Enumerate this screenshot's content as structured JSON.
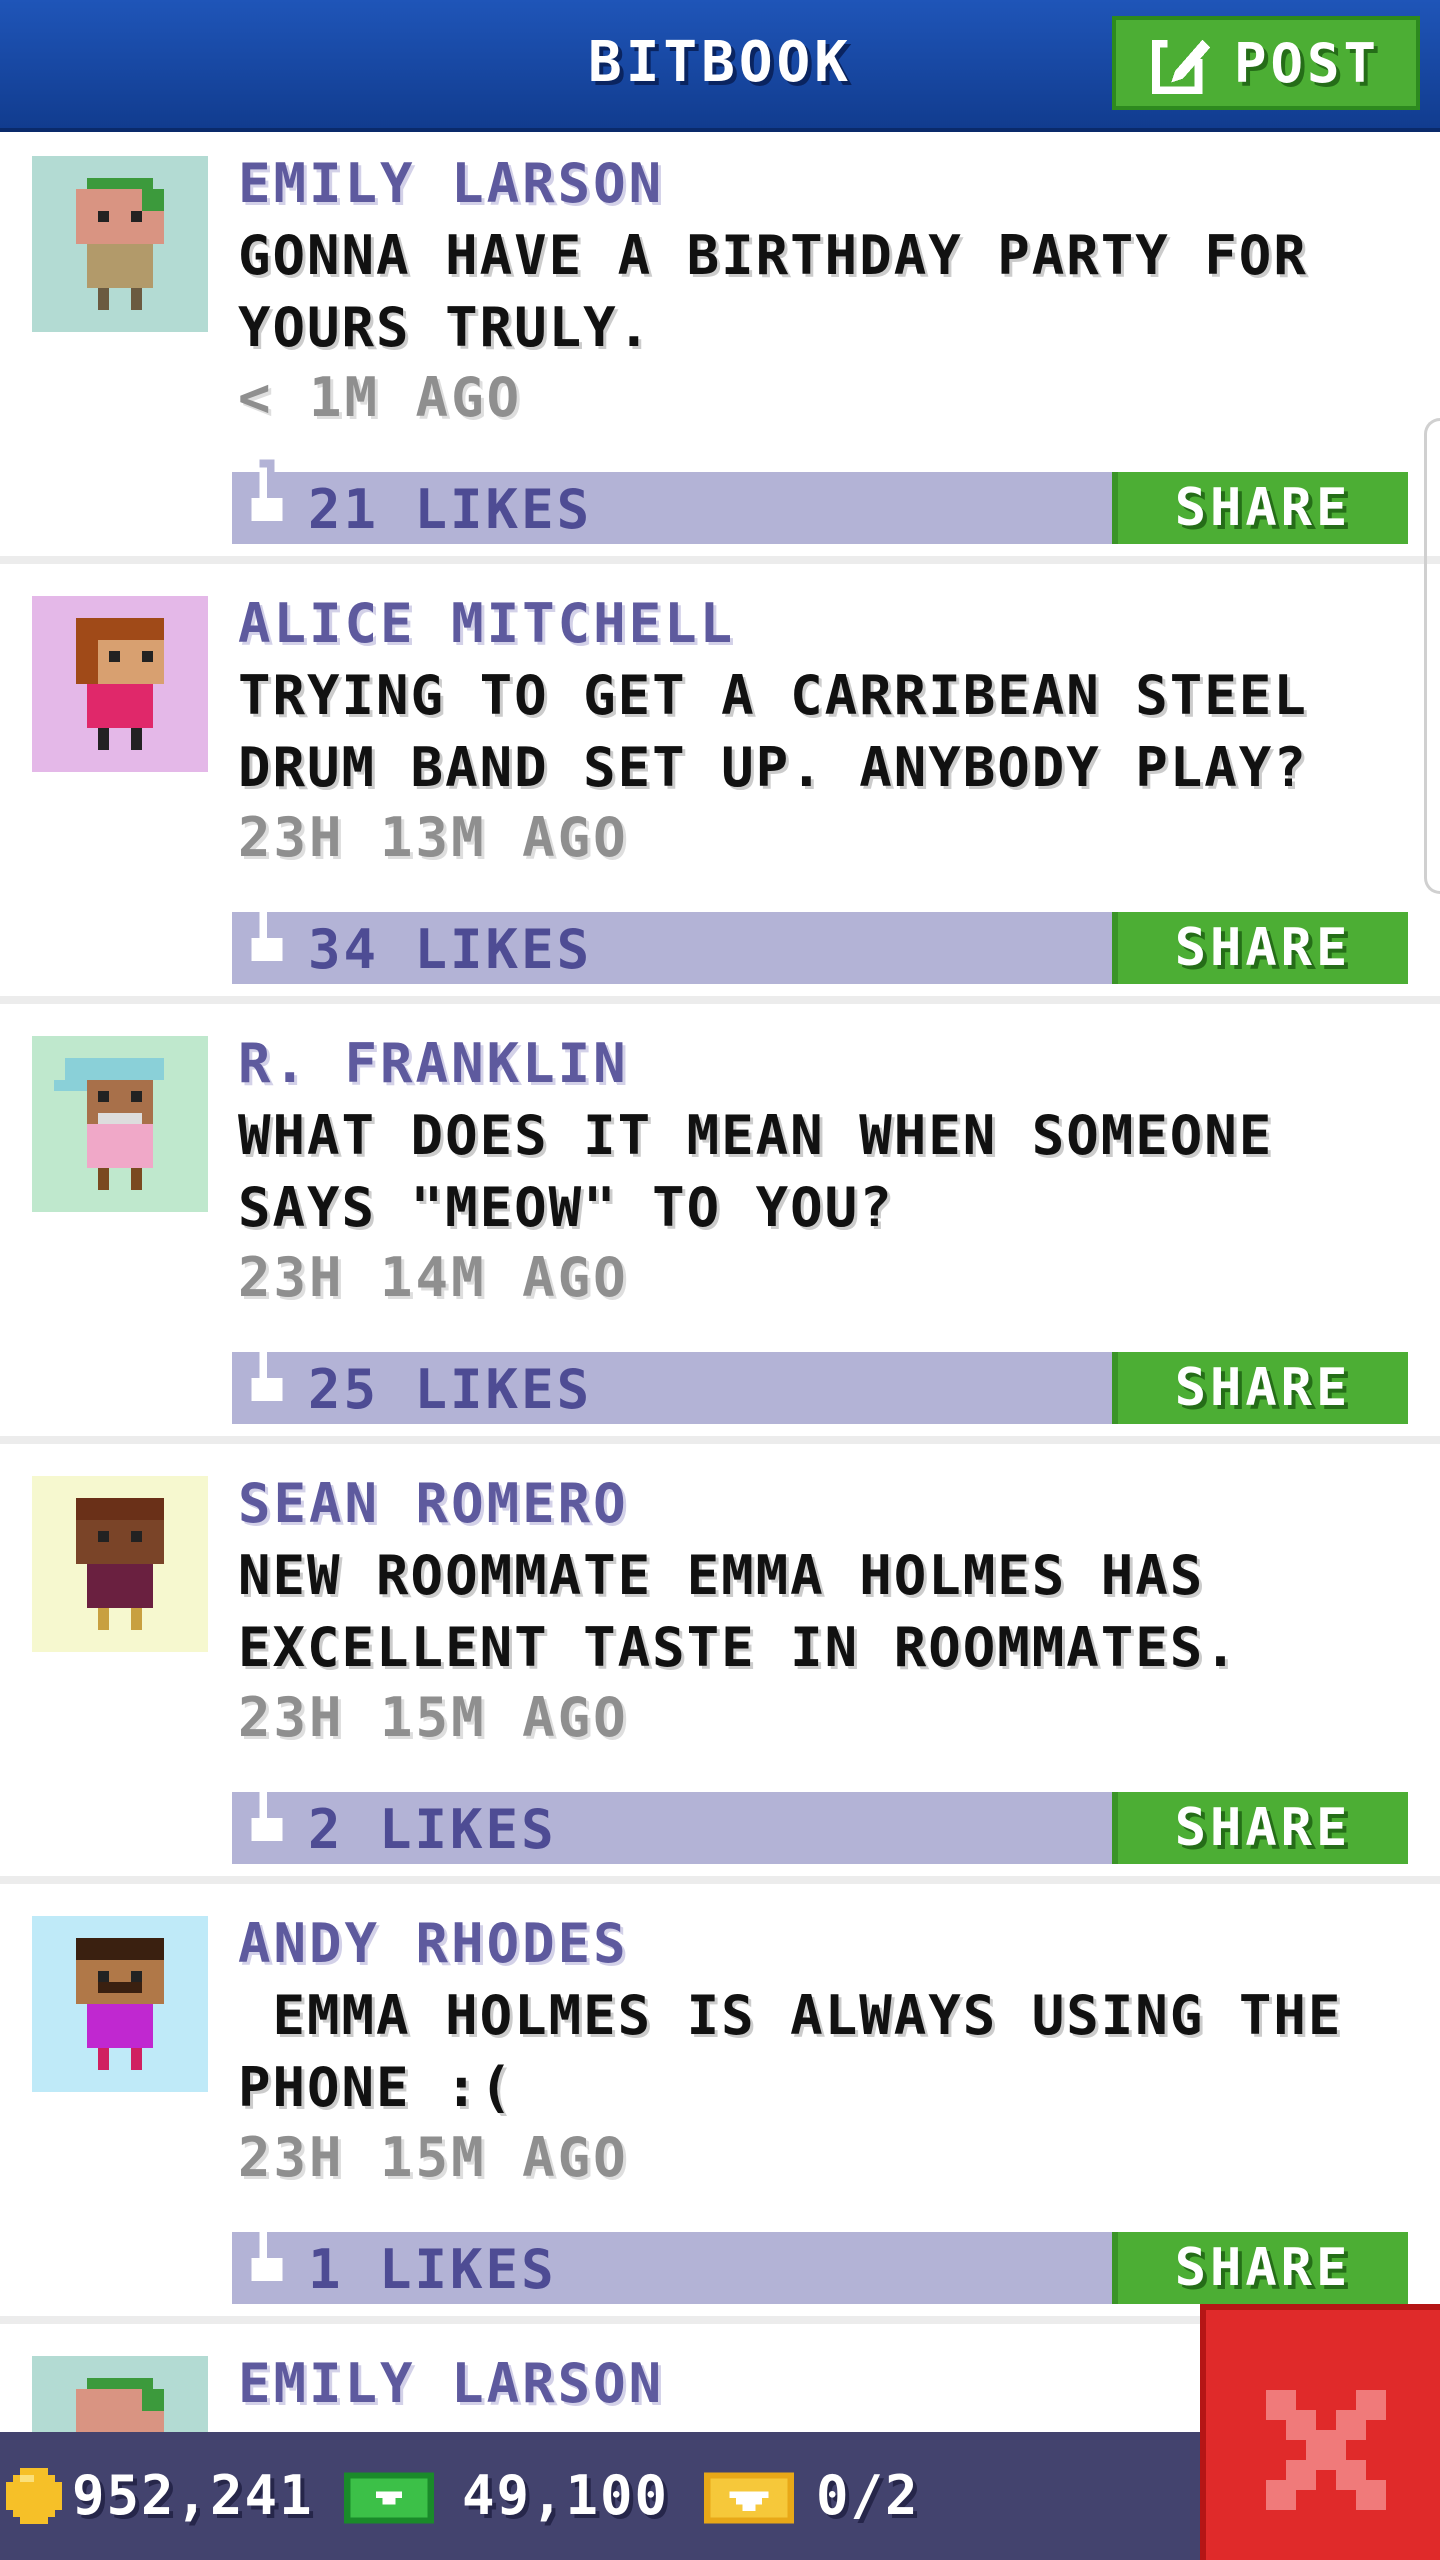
{
  "header": {
    "title": "BITBOOK",
    "post_label": "POST"
  },
  "posts": [
    {
      "author": "EMILY LARSON",
      "text": "GONNA HAVE A BIRTHDAY PARTY FOR YOURS TRULY.",
      "time": "< 1M AGO",
      "likes": "21 LIKES",
      "share": "SHARE"
    },
    {
      "author": "ALICE MITCHELL",
      "text": "TRYING TO GET A CARRIBEAN STEEL DRUM BAND SET UP. ANYBODY PLAY?",
      "time": "23H 13M AGO",
      "likes": "34 LIKES",
      "share": "SHARE"
    },
    {
      "author": "R. FRANKLIN",
      "text": "WHAT DOES IT MEAN WHEN SOMEONE SAYS \"MEOW\" TO YOU?",
      "time": "23H 14M AGO",
      "likes": "25 LIKES",
      "share": "SHARE"
    },
    {
      "author": "SEAN ROMERO",
      "text": "NEW ROOMMATE EMMA HOLMES HAS EXCELLENT TASTE IN ROOMMATES.",
      "time": "23H 15M AGO",
      "likes": "2 LIKES",
      "share": "SHARE"
    },
    {
      "author": "ANDY RHODES",
      "text": " EMMA HOLMES IS ALWAYS USING THE PHONE :(",
      "time": "23H 15M AGO",
      "likes": "1 LIKES",
      "share": "SHARE"
    },
    {
      "author": "EMILY LARSON"
    }
  ],
  "footer": {
    "coins": "952,241",
    "bux": "49,100",
    "tickets": "0/2"
  },
  "colors": {
    "header_blue": "#1a4faa",
    "author_purple": "#5e5a9e",
    "likes_bar": "#b3b3d6",
    "share_green": "#4cae34",
    "close_red": "#e02a2a",
    "footer_navy": "#43436e",
    "avatar_bgs": [
      "#b3dbd3",
      "#e4b8e8",
      "#bfe8cd",
      "#f6f8cf",
      "#bfeaf8",
      "#b3dbd3"
    ]
  }
}
